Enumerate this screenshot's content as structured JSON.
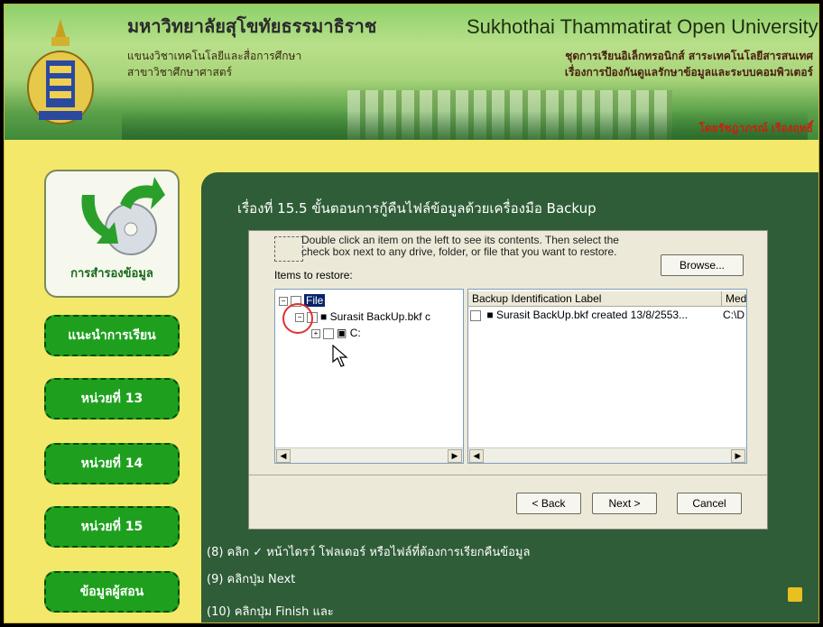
{
  "header": {
    "university_th": "มหาวิทยาลัยสุโขทัยธรรมาธิราช",
    "school_line1": "แขนงวิชาเทคโนโลยีและสื่อการศึกษา",
    "school_line2": "สาขาวิชาศึกษาศาสตร์",
    "university_en": "Sukhothai Thammatirat Open University",
    "series_line1": "ชุดการเรียนอิเล็กทรอนิกส์ สาระเทคโนโลยีสารสนเทศ",
    "series_line2": "เรื่องการป้องกันดูแลรักษาข้อมูลและระบบคอมพิวเตอร์",
    "author": "โดยรัชฎาภรณ์ เรืองฤทธิ์"
  },
  "sidebar": {
    "card_label": "การสำรองข้อมูล",
    "items": [
      {
        "label": "แนะนำการเรียน"
      },
      {
        "label": "หน่วยที่ 13"
      },
      {
        "label": "หน่วยที่ 14"
      },
      {
        "label": "หน่วยที่ 15"
      },
      {
        "label": "ข้อมูลผู้สอน"
      }
    ]
  },
  "content": {
    "title": "เรื่องที่ 15.5 ขั้นตอนการกู้คืนไฟล์ข้อมูลด้วยเครื่องมือ Backup",
    "steps": [
      "(8) คลิก ✓ หน้าไดรว์ โฟลเดอร์ หรือไฟล์ที่ต้องการเรียกคืนข้อมูล",
      "(9) คลิกปุ่ม Next",
      "(10) คลิกปุ่ม Finish และ"
    ]
  },
  "wizard": {
    "instruction_line1": "Double click an item on the left to see its contents. Then select the",
    "instruction_line2": "check box next to any drive, folder, or file that you want to restore.",
    "items_label": "Items to restore:",
    "browse_label": "Browse...",
    "tree": {
      "root": "File",
      "child": "Surasit BackUp.bkf c",
      "drive": "C:"
    },
    "list": {
      "col1": "Backup Identification Label",
      "col2": "Med",
      "row_label": "Surasit BackUp.bkf created 13/8/2553...",
      "row_media": "C:\\D"
    },
    "back_label": "< Back",
    "next_label": "Next >",
    "cancel_label": "Cancel"
  },
  "colors": {
    "panel": "#2f5d38",
    "menu": "#1ea01e",
    "background": "#f4e86a"
  }
}
